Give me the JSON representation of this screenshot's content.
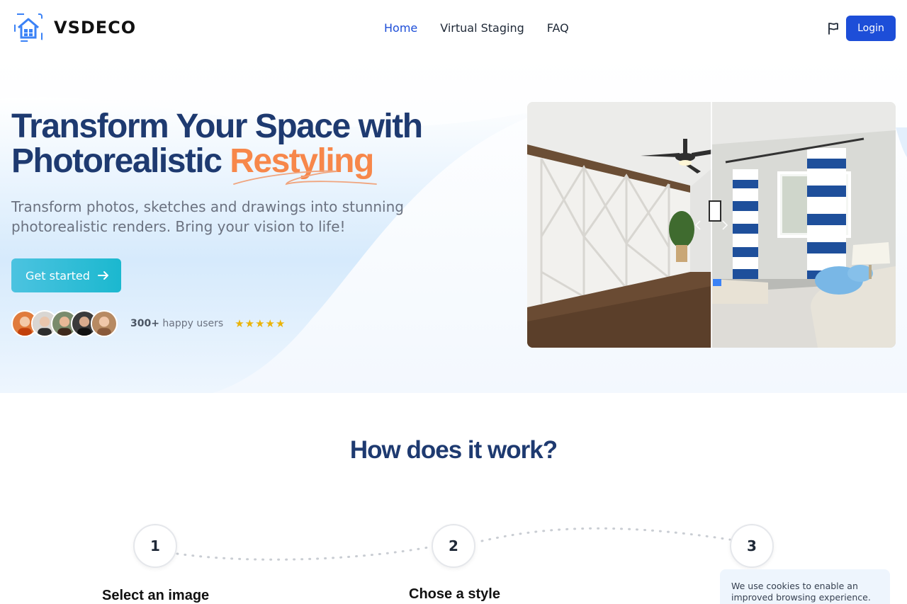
{
  "brand": {
    "name": "VSDECO"
  },
  "nav": {
    "items": [
      {
        "label": "Home",
        "active": true
      },
      {
        "label": "Virtual Staging",
        "active": false
      },
      {
        "label": "FAQ",
        "active": false
      }
    ],
    "language_icon": "flag-icon",
    "login_label": "Login"
  },
  "hero": {
    "title_line1": "Transform Your Space with",
    "title_line2_prefix": "Photorealistic ",
    "title_accent": "Restyling",
    "subtitle": "Transform photos, sketches and drawings into stunning photorealistic renders. Bring your vision to life!",
    "cta_label": "Get started",
    "users_count": "300+",
    "users_text": " happy users",
    "stars": "★★★★★",
    "rating": 5
  },
  "how": {
    "title": "How does it work?",
    "steps": [
      {
        "number": "1",
        "label": "Select an image"
      },
      {
        "number": "2",
        "label": "Chose a style"
      },
      {
        "number": "3",
        "label": ""
      }
    ]
  },
  "cookie": {
    "text": "We use cookies to enable an improved browsing experience."
  },
  "colors": {
    "primary": "#1d4ed8",
    "heading": "#1e3a70",
    "accent": "#f7874a",
    "cta": "#1bb8cf",
    "star": "#eab308"
  }
}
